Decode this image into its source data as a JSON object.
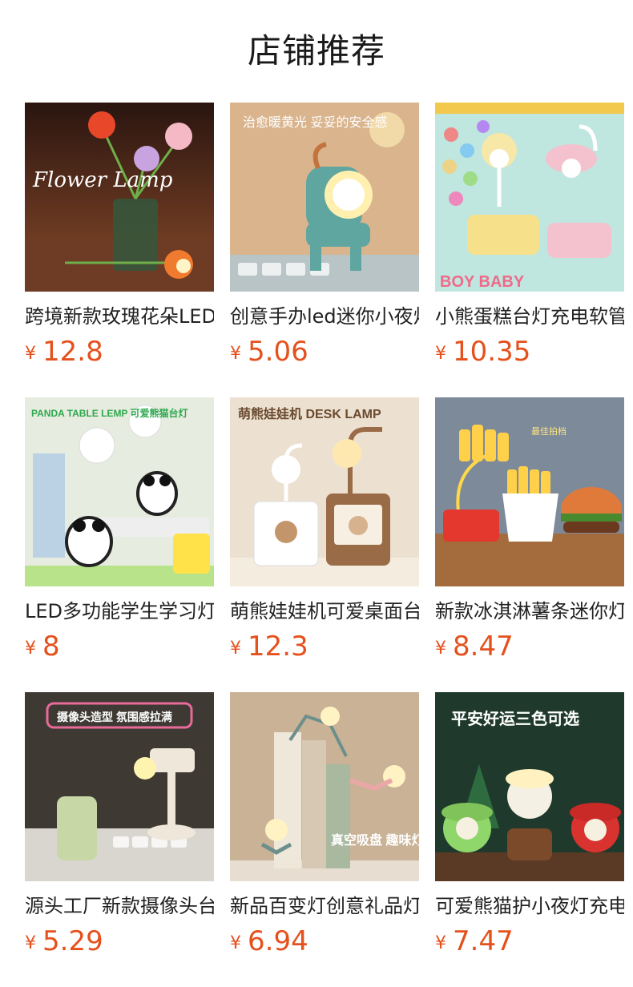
{
  "page": {
    "title": "店铺推荐"
  },
  "products": [
    {
      "name": "跨境新款玫瑰花朵LED台灯",
      "currency": "¥",
      "price": "12.8",
      "image": {
        "tone": "#6b3420",
        "accent": "#e8472a",
        "overlay_text": "Flower Lamp"
      }
    },
    {
      "name": "创意手办led迷你小夜灯",
      "currency": "¥",
      "price": "5.06",
      "image": {
        "tone": "#d8b28c",
        "accent": "#5fa6a0",
        "overlay_text": "治愈暖黄光 妥妥的安全感"
      }
    },
    {
      "name": "小熊蛋糕台灯充电软管",
      "currency": "¥",
      "price": "10.35",
      "image": {
        "tone": "#bfe6df",
        "accent": "#f4c2cf",
        "overlay_text": "BOY BABY"
      }
    },
    {
      "name": "LED多功能学生学习灯",
      "currency": "¥",
      "price": "8",
      "image": {
        "tone": "#dfe8d8",
        "accent": "#2fa84f",
        "overlay_text": "PANDA TABLE LEMP 可爱熊猫台灯"
      }
    },
    {
      "name": "萌熊娃娃机可爱桌面台灯",
      "currency": "¥",
      "price": "12.3",
      "image": {
        "tone": "#e9dccb",
        "accent": "#9a6b47",
        "overlay_text": "萌熊娃娃机 DESK LAMP"
      }
    },
    {
      "name": "新款冰淇淋薯条迷你灯",
      "currency": "¥",
      "price": "8.47",
      "image": {
        "tone": "#7d8a9a",
        "accent": "#e4372d",
        "overlay_text": "最佳拍档"
      }
    },
    {
      "name": "源头工厂新款摄像头台灯",
      "currency": "¥",
      "price": "5.29",
      "image": {
        "tone": "#3e3a33",
        "accent": "#e76a9a",
        "overlay_text": "摄像头造型 氛围感拉满"
      }
    },
    {
      "name": "新品百变灯创意礼品灯",
      "currency": "¥",
      "price": "6.94",
      "image": {
        "tone": "#c9b296",
        "accent": "#6c8f8c",
        "overlay_text": "真空吸盘 趣味灯泡人"
      }
    },
    {
      "name": "可爱熊猫护小夜灯充电",
      "currency": "¥",
      "price": "7.47",
      "image": {
        "tone": "#1f3a2c",
        "accent": "#d8332f",
        "overlay_text": "平安好运三色可选"
      }
    }
  ]
}
